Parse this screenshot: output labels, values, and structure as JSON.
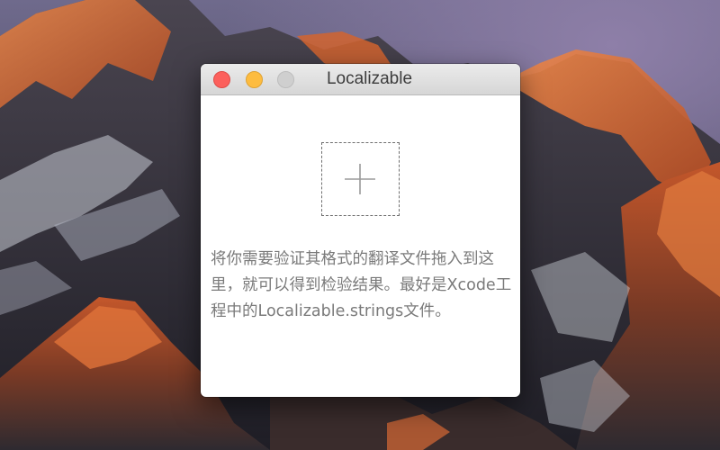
{
  "window": {
    "title": "Localizable"
  },
  "drop_zone": {
    "icon": "plus-icon"
  },
  "instructions": {
    "text": "将你需要验证其格式的翻译文件拖入到这里，就可以得到检验结果。最好是Xcode工程中的Localizable.strings文件。"
  },
  "colors": {
    "close": "#fc605c",
    "minimize": "#fdbc40",
    "zoom_disabled": "#cfcfcf",
    "text": "#7a7a7a"
  }
}
